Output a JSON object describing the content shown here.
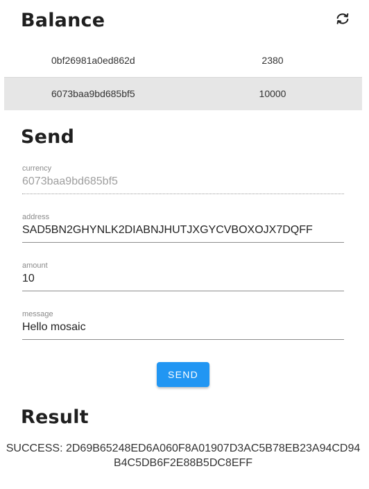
{
  "balance": {
    "title": "Balance",
    "refresh_icon": "refresh-icon",
    "rows": [
      {
        "id": "0bf26981a0ed862d",
        "amount": "2380"
      },
      {
        "id": "6073baa9bd685bf5",
        "amount": "10000"
      }
    ]
  },
  "send": {
    "title": "Send",
    "currency": {
      "label": "currency",
      "value": "6073baa9bd685bf5"
    },
    "address": {
      "label": "address",
      "value": "SAD5BN2GHYNLK2DIABNJHUTJXGYCVBOXOJX7DQFF"
    },
    "amount": {
      "label": "amount",
      "value": "10"
    },
    "message": {
      "label": "message",
      "value": "Hello mosaic"
    },
    "button_label": "SEND",
    "button_color": "#2196f3"
  },
  "result": {
    "title": "Result",
    "text": "SUCCESS: 2D69B65248ED6A060F8A01907D3AC5B78EB23A94CD94B4C5DB6F2E88B5DC8EFF"
  }
}
